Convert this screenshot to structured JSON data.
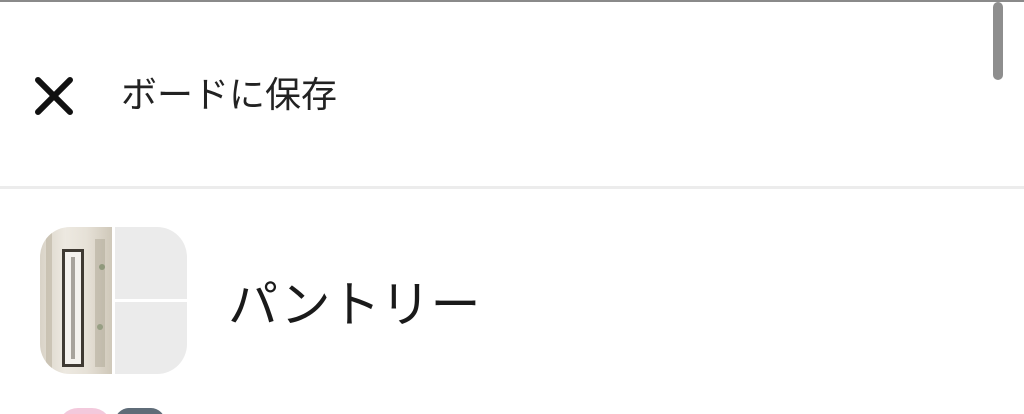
{
  "header": {
    "title": "ボードに保存",
    "close_icon": "close-icon"
  },
  "boards": [
    {
      "name": "パントリー"
    }
  ]
}
